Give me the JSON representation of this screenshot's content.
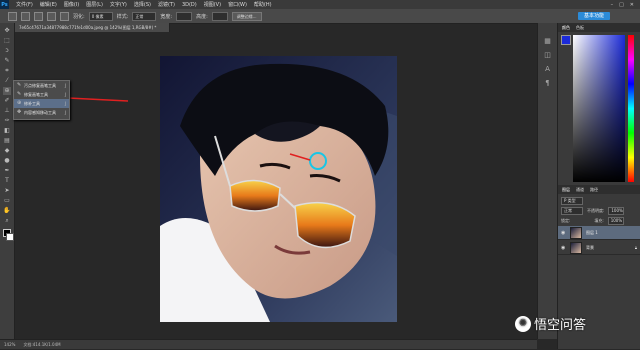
{
  "app": {
    "logo": "Ps"
  },
  "menubar": {
    "items": [
      "文件(F)",
      "编辑(E)",
      "图像(I)",
      "图层(L)",
      "文字(Y)",
      "选择(S)",
      "滤镜(T)",
      "3D(D)",
      "视图(V)",
      "窗口(W)",
      "帮助(H)"
    ],
    "window_controls": [
      "–",
      "□",
      "✕"
    ]
  },
  "options_bar": {
    "feather_label": "羽化:",
    "feather_value": "0 像素",
    "style_label": "样式:",
    "style_value": "正常",
    "width_label": "宽度:",
    "height_label": "高度:",
    "refine_button": "调整边缘...",
    "share_button": "基本功能"
  },
  "document_tab": {
    "title": "7e65c47671a34877988c771fe1d00a.jpeg @ 142%(图层 1,RGB/8#) *"
  },
  "tool_flyout": {
    "items": [
      {
        "icon": "quick-select-icon",
        "label": "污点修复画笔工具",
        "key": "J",
        "active": false
      },
      {
        "icon": "healing-brush-icon",
        "label": "修复画笔工具",
        "key": "J",
        "active": false
      },
      {
        "icon": "patch-icon",
        "label": "修补工具",
        "key": "J",
        "active": true
      },
      {
        "icon": "content-aware-move-icon",
        "label": "内容感知移动工具",
        "key": "J",
        "active": false
      },
      {
        "icon": "red-eye-icon",
        "label": "红眼工具",
        "key": "J",
        "active": false
      }
    ]
  },
  "status_bar": {
    "zoom": "142%",
    "doc_info": "文档:414.1K/1.04M"
  },
  "right_panel": {
    "top_tabs": [
      "颜色",
      "色板"
    ],
    "layers_tabs": [
      "图层",
      "通道",
      "路径"
    ],
    "filter_label": "P 类型",
    "blend_mode": "正常",
    "opacity_label": "不透明度:",
    "opacity_value": "100%",
    "lock_label": "锁定:",
    "fill_label": "填充:",
    "fill_value": "100%",
    "layers": [
      {
        "name": "图层 1",
        "selected": true
      },
      {
        "name": "背景",
        "selected": false
      }
    ]
  },
  "annotations": {
    "arrow_color": "#e02020",
    "circle_color": "#19c6e6"
  },
  "watermark": {
    "text": "悟空问答"
  }
}
